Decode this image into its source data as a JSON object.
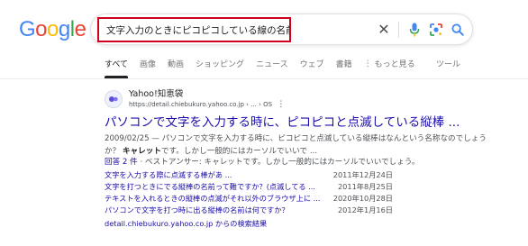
{
  "logo": {
    "letters": [
      "G",
      "o",
      "o",
      "g",
      "l",
      "e"
    ],
    "colors": [
      "#4285F4",
      "#EA4335",
      "#FBBC05",
      "#4285F4",
      "#34A853",
      "#EA4335"
    ]
  },
  "search": {
    "query": "文字入力のときにピコピコしている線の名前",
    "highlight_color": "#d0021b"
  },
  "tabs": {
    "items": [
      "すべて",
      "画像",
      "動画",
      "ショッピング",
      "ニュース",
      "ウェブ",
      "書籍"
    ],
    "more_label": "もっと見る",
    "tools_label": "ツール"
  },
  "result": {
    "site_name": "Yahoo!知恵袋",
    "url": "https://detail.chiebukuro.yahoo.co.jp › ... › OS",
    "title": "パソコンで文字を入力する時に、ピコピコと点滅している縦棒 ...",
    "snippet_part1": "2009/02/25 — パソコンで文字を入力する時に、ピコピコと点滅している縦棒はなんという名称なのでしょうか？",
    "snippet_bold": "キャレット",
    "snippet_part2": "です。しかし一般的にはカーソルでいいで ...",
    "answer_count": "回答 2 件",
    "answer_text": "· ベストアンサー: キャレットです。しかし一般的にはカーソルでいいでしょう。",
    "related": [
      {
        "text": "文字を入力する際に点滅する棒があ ...",
        "date": "2011年12月24日"
      },
      {
        "text": "文字を打つときにでる縦棒の名前って難ですか？(点滅してる ...",
        "date": "2011年8月25日"
      },
      {
        "text": "テキストを入れるときの縦棒の点滅がそれ以外のブラウザ上に ...",
        "date": "2020年10月28日"
      },
      {
        "text": "パソコンで文字を打つ時に出る縦棒の名前は何ですか？",
        "date": "2012年1月16日"
      }
    ],
    "more_results": "detail.chiebukuro.yahoo.co.jp からの検索結果"
  }
}
